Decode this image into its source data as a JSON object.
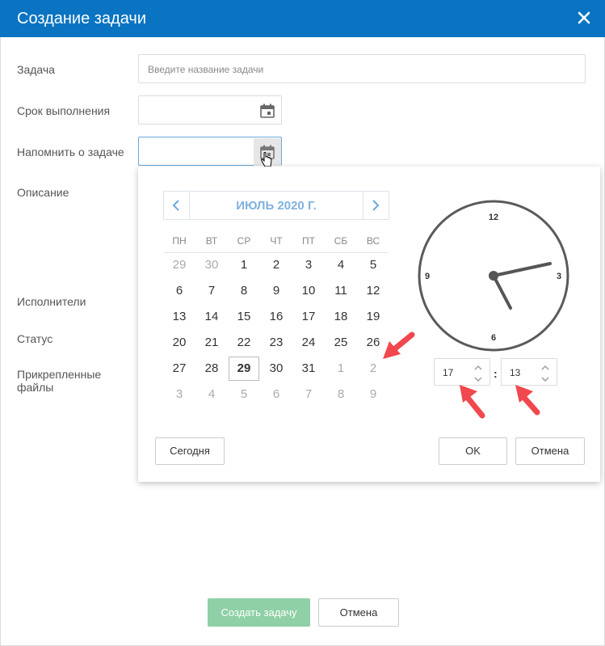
{
  "dialog": {
    "title": "Создание задачи"
  },
  "form": {
    "task_label": "Задача",
    "task_placeholder": "Введите название задачи",
    "deadline_label": "Срок выполнения",
    "reminder_label": "Напомнить о задаче",
    "description_label": "Описание",
    "assignees_label": "Исполнители",
    "status_label": "Статус",
    "attachments_label_line1": "Прикрепленные",
    "attachments_label_line2": "файлы"
  },
  "calendar": {
    "month_title": "ИЮЛЬ 2020 Г.",
    "weekdays": [
      "ПН",
      "ВТ",
      "СР",
      "ЧТ",
      "ПТ",
      "СБ",
      "ВС"
    ],
    "weeks": [
      [
        {
          "d": "29",
          "o": true
        },
        {
          "d": "30",
          "o": true
        },
        {
          "d": "1"
        },
        {
          "d": "2"
        },
        {
          "d": "3"
        },
        {
          "d": "4"
        },
        {
          "d": "5"
        }
      ],
      [
        {
          "d": "6"
        },
        {
          "d": "7"
        },
        {
          "d": "8"
        },
        {
          "d": "9"
        },
        {
          "d": "10"
        },
        {
          "d": "11"
        },
        {
          "d": "12"
        }
      ],
      [
        {
          "d": "13"
        },
        {
          "d": "14"
        },
        {
          "d": "15"
        },
        {
          "d": "16"
        },
        {
          "d": "17"
        },
        {
          "d": "18"
        },
        {
          "d": "19"
        }
      ],
      [
        {
          "d": "20"
        },
        {
          "d": "21"
        },
        {
          "d": "22"
        },
        {
          "d": "23"
        },
        {
          "d": "24"
        },
        {
          "d": "25"
        },
        {
          "d": "26"
        }
      ],
      [
        {
          "d": "27"
        },
        {
          "d": "28"
        },
        {
          "d": "29",
          "sel": true
        },
        {
          "d": "30"
        },
        {
          "d": "31"
        },
        {
          "d": "1",
          "o": true
        },
        {
          "d": "2",
          "o": true
        }
      ],
      [
        {
          "d": "3",
          "o": true
        },
        {
          "d": "4",
          "o": true
        },
        {
          "d": "5",
          "o": true
        },
        {
          "d": "6",
          "o": true
        },
        {
          "d": "7",
          "o": true
        },
        {
          "d": "8",
          "o": true
        },
        {
          "d": "9",
          "o": true
        }
      ]
    ],
    "today_button": "Сегодня",
    "ok_button": "OK",
    "cancel_button": "Отмена"
  },
  "clock": {
    "labels": {
      "n12": "12",
      "n3": "3",
      "n6": "6",
      "n9": "9"
    },
    "hours": "17",
    "minutes": "13",
    "separator": ":"
  },
  "footer": {
    "create_button": "Создать задачу",
    "cancel_button": "Отмена"
  },
  "colors": {
    "accent": "#0a74c2",
    "create_button_bg": "#8fd0a6",
    "month_title": "#7fb1e0"
  }
}
